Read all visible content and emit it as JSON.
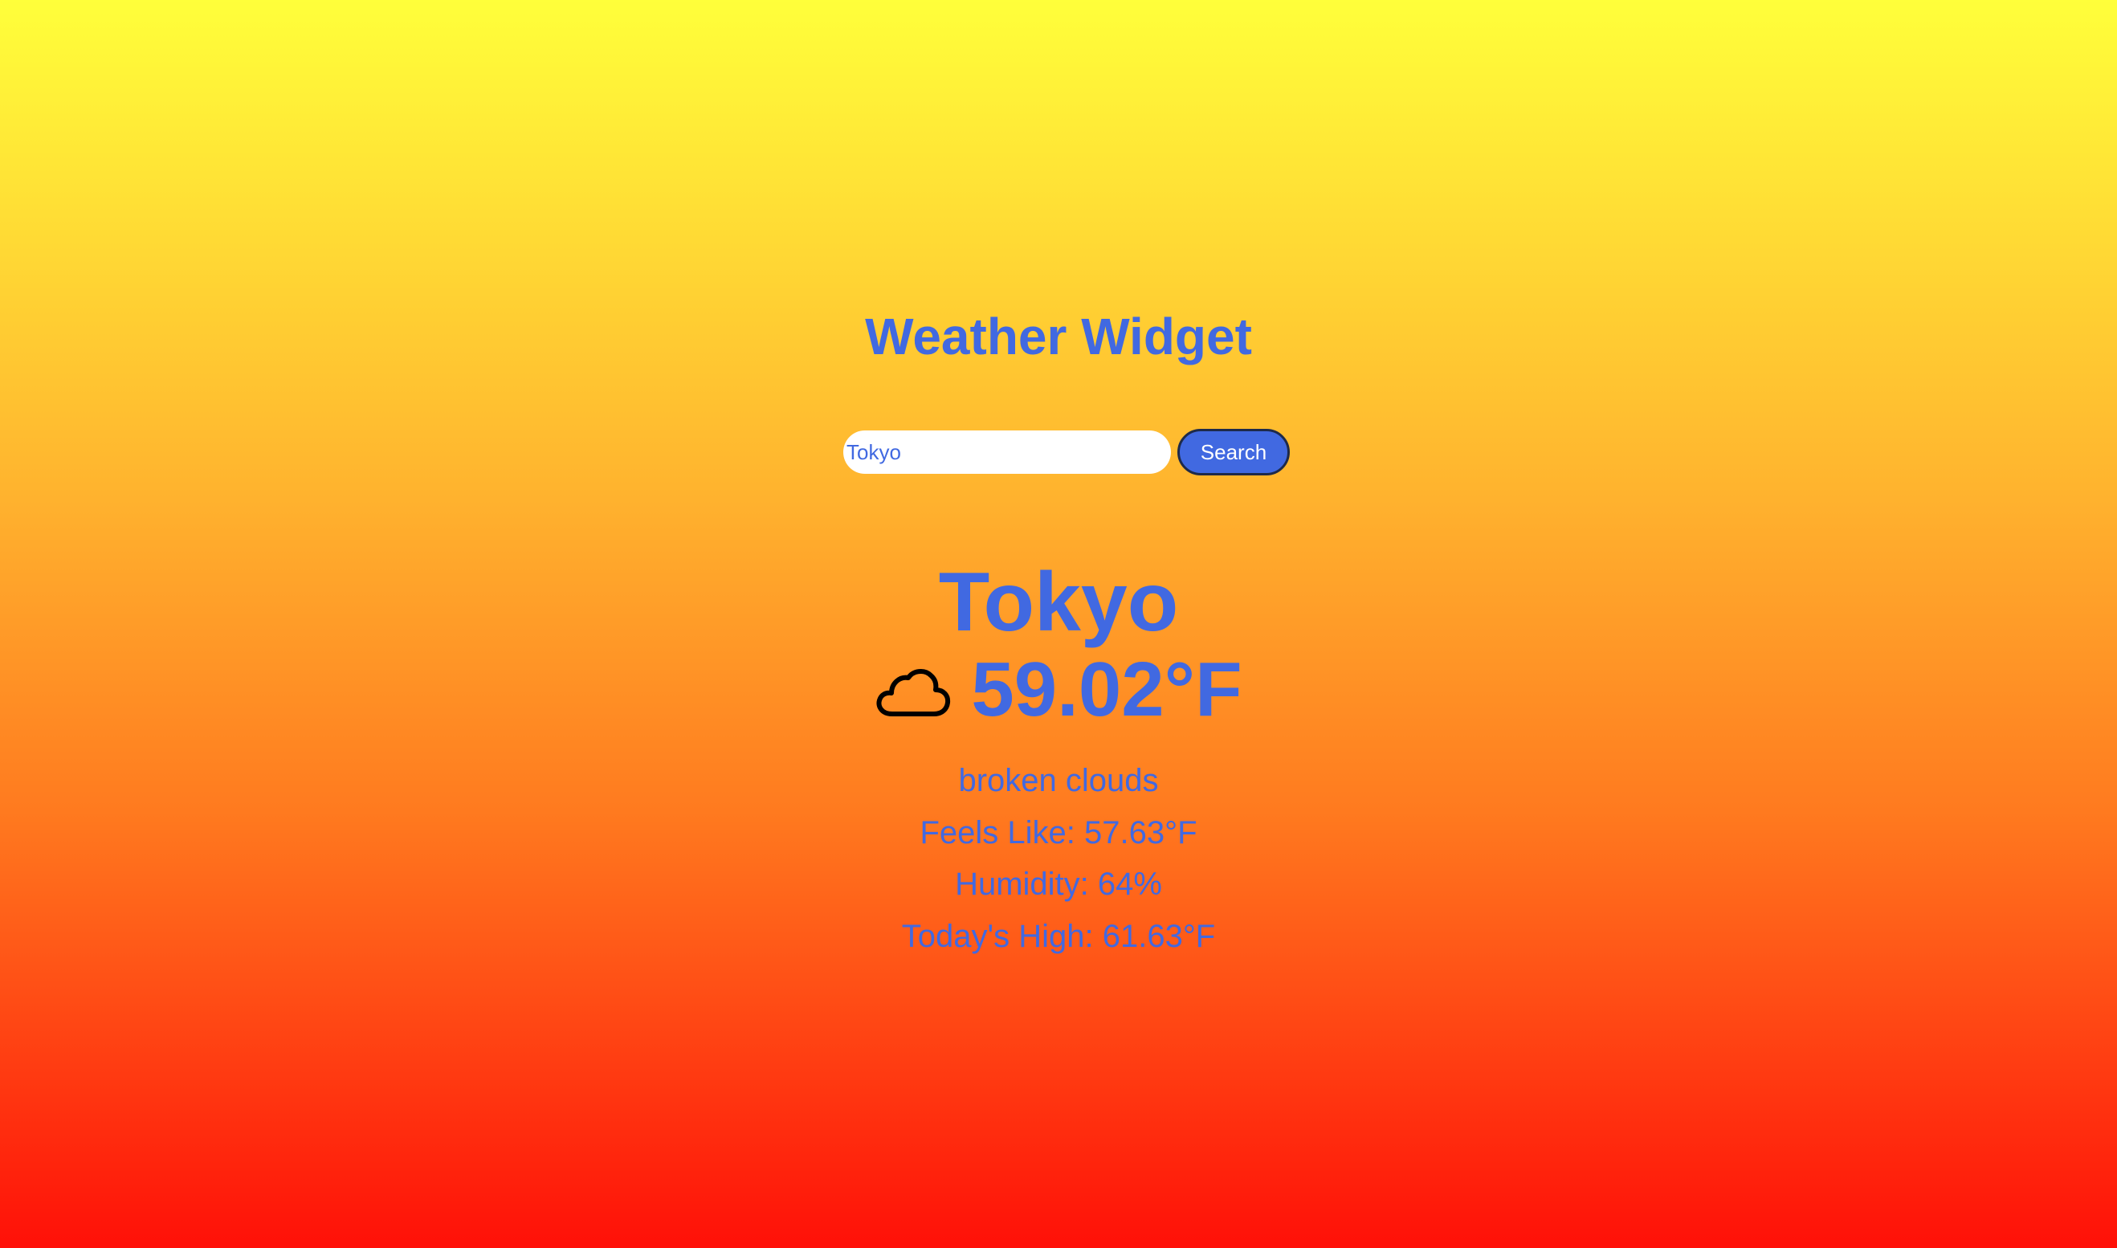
{
  "app": {
    "title": "Weather Widget"
  },
  "search": {
    "value": "Tokyo",
    "button_label": "Search"
  },
  "weather": {
    "city": "Tokyo",
    "icon": "cloud-icon",
    "temperature": "59.02°F",
    "description": "broken clouds",
    "feels_like": "Feels Like: 57.63°F",
    "humidity": "Humidity: 64%",
    "high": "Today's High: 61.63°F"
  },
  "colors": {
    "accent": "#4169e1",
    "gradient_top": "#ffff3a",
    "gradient_bottom": "#ff1008"
  }
}
